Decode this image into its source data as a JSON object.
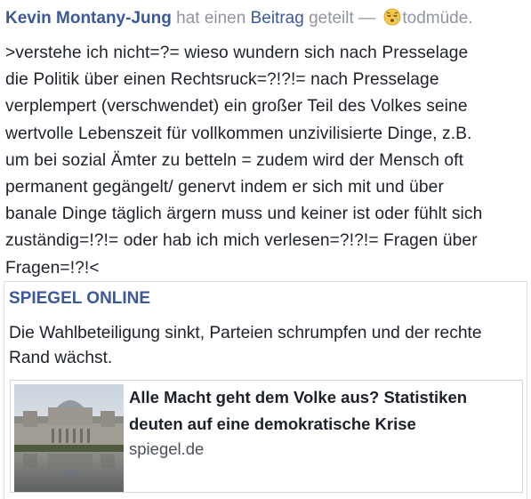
{
  "post": {
    "author": "Kevin Montany-Jung",
    "action_before": " hat einen ",
    "post_link": "Beitrag",
    "action_after": " geteilt — ",
    "feeling_icon": "sleepy-face-icon",
    "feeling": "todmüde.",
    "body": ">verstehe ich nicht=?= wieso wundern sich nach Presselage\ndie Politik über einen Rechtsruck=?!?!= nach Presselage\nverplempert (verschwendet) ein großer Teil des Volkes seine\nwertvolle Lebenszeit für vollkommen unzivilisierte Dinge, z.B.\num bei sozial Ämter zu betteln = zudem wird der Mensch oft\npermanent gegängelt/ genervt indem er sich mit und über\nbanale Dinge täglich ärgern muss und keiner ist oder fühlt sich\nzuständig=!?!= oder hab ich mich verlesen=?!?!= Fragen über\nFragen=!?!<"
  },
  "shared": {
    "source": "SPIEGEL ONLINE",
    "summary": "Die Wahlbeteiligung sinkt, Parteien schrumpfen und der rechte Rand wächst.",
    "link": {
      "title": "Alle Macht geht dem Volke aus? Statistiken deuten auf eine demokratische Krise",
      "domain": "spiegel.de"
    }
  },
  "colors": {
    "link": "#3b5998",
    "meta_text": "#90949c",
    "body_text": "#1d2129",
    "border": "#dddfe2"
  }
}
